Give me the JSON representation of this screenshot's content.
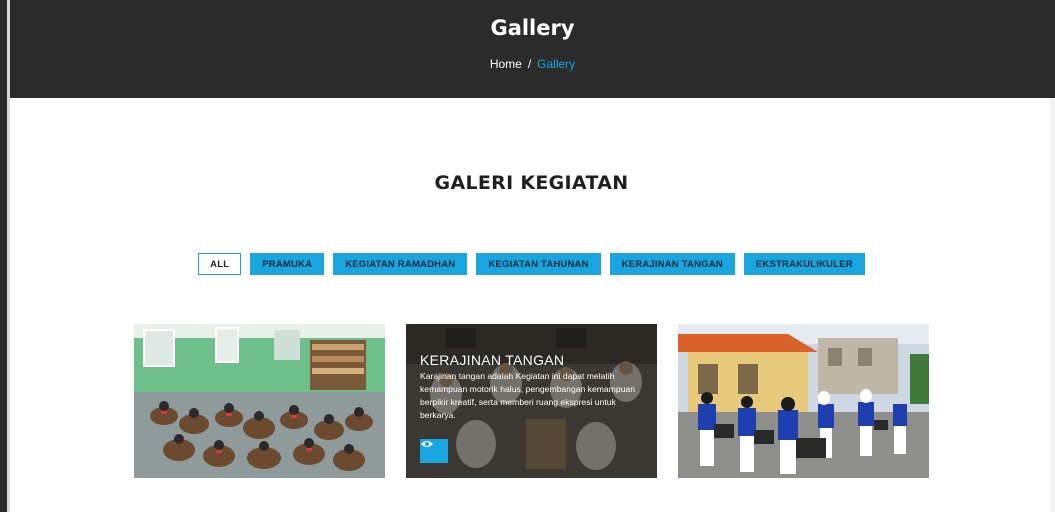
{
  "header": {
    "title": "Gallery",
    "breadcrumb": {
      "home": "Home",
      "separator": "/",
      "current": "Gallery"
    }
  },
  "section": {
    "title": "GALERI KEGIATAN"
  },
  "filters": [
    {
      "label": "ALL",
      "active": true
    },
    {
      "label": "PRAMUKA",
      "active": false
    },
    {
      "label": "KEGIATAN RAMADHAN",
      "active": false
    },
    {
      "label": "KEGIATAN TAHUNAN",
      "active": false
    },
    {
      "label": "KERAJINAN TANGAN",
      "active": false
    },
    {
      "label": "EKSTRAKULIKULER",
      "active": false
    }
  ],
  "gallery": {
    "items": [
      {
        "photo_subject": "classroom-scouts"
      },
      {
        "photo_subject": "handicraft-students",
        "overlay_title": "KERAJINAN TANGAN",
        "overlay_desc": "Karajinan tangan adalah Kegiatan ini dapat melatih kemampuan motorik halus, pengembangan kemampuan berpikir kreatif, serta memberi ruang ekspresi untuk berkarya.",
        "button_icon": "eye-icon"
      },
      {
        "photo_subject": "drum-band"
      }
    ]
  },
  "colors": {
    "accent": "#18a5e0",
    "header_bg": "#2b2b2b",
    "content_bg": "#ffffff"
  }
}
